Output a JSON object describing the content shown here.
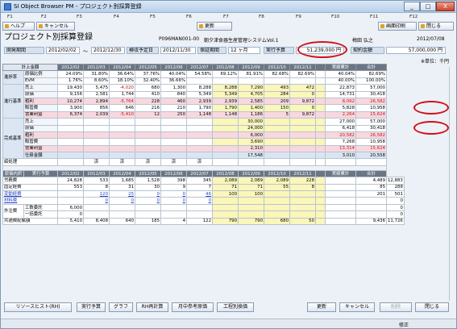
{
  "window": {
    "title": "SI Object Browser PM - プロジェクト別採算登録",
    "icon": "app-icon",
    "min_label": "_",
    "max_label": "□",
    "close_label": "X"
  },
  "fkeys": [
    "F1",
    "F2",
    "F3",
    "F4",
    "F5",
    "F6",
    "F7",
    "F8",
    "F9",
    "F10",
    "F11",
    "F12"
  ],
  "toolbar": {
    "help": "ヘルプ",
    "cancel": "キャンセル",
    "refresh": "更新",
    "print_screen": "画面印刷",
    "close": "閉じる"
  },
  "page": {
    "title": "プロジェクト別採算登録",
    "project_no": "P096MAN001-00",
    "client": "朝夕津食器",
    "project_name": "生産管理システムVol.1",
    "manager": "梅田 弘之",
    "date": "2012/07/08"
  },
  "header": {
    "period_label": "開発期間",
    "period_from": "2012/02/02",
    "period_sep": "〜",
    "period_to": "2012/12/30",
    "inspect_label": "検収予定日",
    "inspect_value": "2012/11/30",
    "warranty_label": "保証期間",
    "warranty_value": "12 ヶ月",
    "exec_budget_label": "実行予算",
    "exec_budget_value": "51,239,000 円",
    "contract_label": "契約金額",
    "contract_value": "57,000,000 円",
    "unit": "※単位：千円"
  },
  "grid": {
    "months": [
      "計上金額",
      "2012/02",
      "2012/03",
      "2012/04",
      "2012/05",
      "2012/06",
      "2012/07",
      "2012/08",
      "2012/09",
      "2012/10",
      "2012/11",
      "",
      "実績累計",
      "合計"
    ],
    "progress_section": "進捗率",
    "progress": [
      {
        "label": "原価比例",
        "v": [
          "24.09%",
          "31.80%",
          "36.64%",
          "37.76%",
          "40.04%",
          "54.58%",
          "69.12%",
          "81.91%",
          "82.68%",
          "82.69%",
          "",
          "40.04%",
          "82.69%"
        ]
      },
      {
        "label": "EVM",
        "v": [
          "1.76%",
          "8.60%",
          "18.10%",
          "32.40%",
          "36.66%",
          "",
          "",
          "",
          "",
          "",
          "",
          "40.00%",
          "100.00%"
        ]
      }
    ],
    "actual_section": "進行基準",
    "actual": [
      {
        "label": "売上",
        "cls": "",
        "v": [
          "19,430",
          "5,475",
          "-4,020",
          "680",
          "1,300",
          "8,288",
          "8,288",
          "7,290",
          "493",
          "472",
          "",
          "22,873",
          "57,000"
        ]
      },
      {
        "label": "原価",
        "cls": "",
        "v": [
          "9,156",
          "2,581",
          "1,744",
          "410",
          "840",
          "5,349",
          "5,349",
          "4,705",
          "284",
          "0",
          "",
          "14,731",
          "30,418"
        ]
      },
      {
        "label": "粗利",
        "cls": "pink",
        "v": [
          "10,274",
          "2,894",
          "-5,764",
          "228",
          "460",
          "2,939",
          "2,939",
          "2,585",
          "209",
          "9,872",
          "",
          "8,092",
          "26,582"
        ]
      },
      {
        "label": "販管費",
        "cls": "",
        "v": [
          "3,900",
          "856",
          "646",
          "216",
          "210",
          "1,790",
          "1,790",
          "1,400",
          "150",
          "0",
          "",
          "5,828",
          "10,958"
        ]
      },
      {
        "label": "営業利益",
        "cls": "pink",
        "v": [
          "6,374",
          "2,039",
          "-5,410",
          "12",
          "250",
          "1,148",
          "1,148",
          "1,186",
          "5",
          "9,872",
          "",
          "2,264",
          "15,624"
        ]
      }
    ],
    "complete_section": "完成基準",
    "complete": [
      {
        "label": "売上",
        "cls": "",
        "v": [
          "",
          "",
          "",
          "",
          "",
          "",
          "",
          "30,000",
          "",
          "",
          "",
          "27,000",
          "57,000"
        ]
      },
      {
        "label": "原価",
        "cls": "",
        "v": [
          "",
          "",
          "",
          "",
          "",
          "",
          "",
          "24,000",
          "",
          "",
          "",
          "6,418",
          "30,418"
        ]
      },
      {
        "label": "粗利",
        "cls": "pink",
        "v": [
          "",
          "",
          "",
          "",
          "",
          "",
          "",
          "6,000",
          "",
          "",
          "",
          "20,582",
          "26,582"
        ]
      },
      {
        "label": "販管費",
        "cls": "",
        "v": [
          "",
          "",
          "",
          "",
          "",
          "",
          "",
          "3,690",
          "",
          "",
          "",
          "7,268",
          "10,958"
        ]
      },
      {
        "label": "営業利益",
        "cls": "pink",
        "v": [
          "",
          "",
          "",
          "",
          "",
          "",
          "",
          "2,310",
          "",
          "",
          "",
          "13,314",
          "15,624"
        ]
      },
      {
        "label": "仕掛金額",
        "cls": "blu",
        "v": [
          "",
          "",
          "",
          "",
          "",
          "",
          "",
          "17,548",
          "",
          "",
          "",
          "3,010",
          "20,558"
        ]
      }
    ],
    "settle_label": "締処理",
    "settle": [
      "",
      "済",
      "済",
      "済",
      "済",
      "済",
      "",
      "",
      "",
      "",
      "",
      "",
      ""
    ],
    "cost_header": [
      "原価内訳",
      "実行予算",
      "2012/02",
      "2012/03",
      "2012/04",
      "2012/05",
      "2012/06",
      "2012/07",
      "2012/08",
      "2012/09",
      "2012/10",
      "2012/11",
      "",
      "実績累計",
      "合計"
    ],
    "cost": [
      {
        "label": "労務費",
        "sub": "",
        "link": false,
        "v": [
          "24,828",
          "533",
          "1,685",
          "1,528",
          "398",
          "345",
          "2,089",
          "2,089",
          "2,089",
          "228",
          "",
          "",
          "4,489",
          "12,883"
        ]
      },
      {
        "label": "固定経費",
        "sub": "",
        "link": false,
        "v": [
          "553",
          "8",
          "31",
          "30",
          "9",
          "7",
          "71",
          "71",
          "55",
          "8",
          "",
          "",
          "85",
          "288"
        ]
      },
      {
        "label": "変動経費",
        "sub": "",
        "link": true,
        "v": [
          "",
          "120",
          "25",
          "0",
          "0",
          "46",
          "100",
          "100",
          "",
          "",
          "",
          "",
          "201",
          "501"
        ]
      },
      {
        "label": "材料費",
        "sub": "",
        "link": true,
        "v": [
          "",
          "0",
          "0",
          "0",
          "0",
          "0",
          "",
          "",
          "",
          "",
          "",
          "",
          "",
          "0"
        ]
      },
      {
        "label": "外注費",
        "sub": "工数委託",
        "link": false,
        "v": [
          "6,000",
          "",
          "",
          "",
          "",
          "",
          "",
          "",
          "",
          "",
          "",
          "",
          "",
          "0"
        ]
      },
      {
        "label": "",
        "sub": "一括委託",
        "link": false,
        "v": [
          "0",
          "",
          "",
          "",
          "",
          "",
          "",
          "",
          "",
          "",
          "",
          "",
          "",
          "0"
        ]
      },
      {
        "label": "共通費配賦額",
        "sub": "",
        "link": false,
        "v": [
          "5,410",
          "8,408",
          "640",
          "185",
          "4",
          "122",
          "790",
          "790",
          "680",
          "50",
          "",
          "",
          "9,436",
          "11,726"
        ]
      }
    ]
  },
  "buttons": {
    "history": "リソースヒスト(RH)",
    "budget": "実行予算",
    "graph": "グラフ",
    "rh_calc": "RH再計算",
    "monthly": "月中参考原価",
    "schedule": "工程別換価",
    "update": "更新",
    "cancel": "キャンセル",
    "delete": "削除",
    "close": "閉じる"
  },
  "status": {
    "text1": "",
    "text2": "修正"
  },
  "colors": {
    "header_bg": "#6b7684",
    "pink": "#f7d2da",
    "yellow": "#fbf6b9",
    "oval": "#d0101a",
    "link": "#2a46c8"
  }
}
